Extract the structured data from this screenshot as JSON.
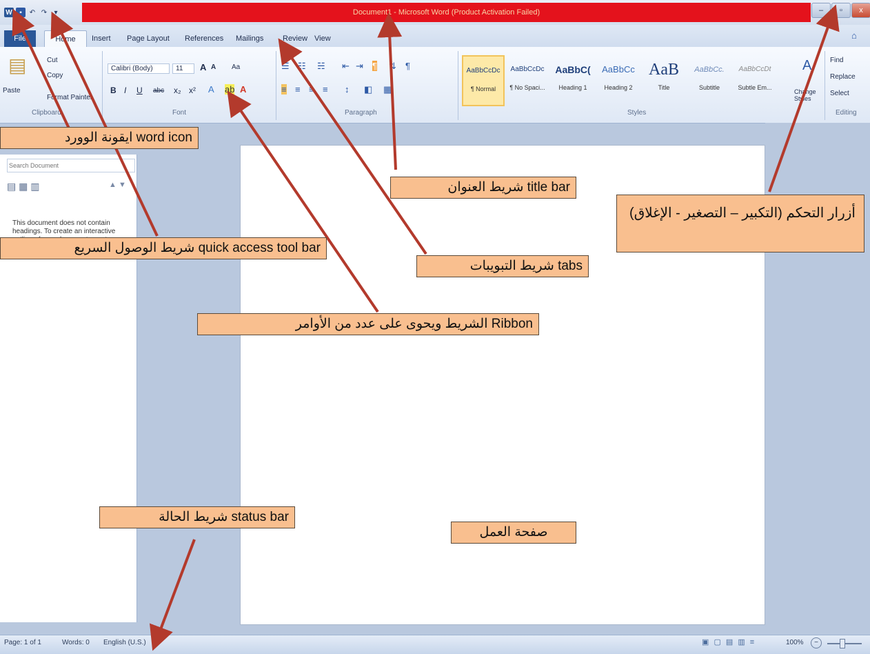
{
  "title_bar": {
    "title": "Document1 - Microsoft Word (Product Activation Failed)"
  },
  "quick_access": {
    "icons": [
      "word-icon",
      "save-icon",
      "undo-icon",
      "redo-icon",
      "customize-icon"
    ]
  },
  "window_controls": {
    "minimize": "–",
    "restore": "▫",
    "close": "x"
  },
  "tabs": {
    "file": "File",
    "home": "Home",
    "insert": "Insert",
    "page_layout": "Page Layout",
    "references": "References",
    "mailings": "Mailings",
    "review": "Review",
    "view": "View"
  },
  "ribbon": {
    "clipboard": {
      "label": "Clipboard",
      "paste": "Paste",
      "cut": "Cut",
      "copy": "Copy",
      "format_painter": "Format Painter"
    },
    "font": {
      "label": "Font",
      "font_name": "Calibri (Body)",
      "font_size": "11",
      "bold": "B",
      "italic": "I",
      "underline": "U",
      "strike": "abc",
      "subscript": "x₂",
      "superscript": "x²",
      "grow": "A",
      "shrink": "A",
      "change_case": "Aa"
    },
    "paragraph": {
      "label": "Paragraph"
    },
    "styles": {
      "label": "Styles",
      "items": [
        {
          "sample": "AaBbCcDc",
          "name": "¶ Normal"
        },
        {
          "sample": "AaBbCcDc",
          "name": "¶ No Spaci..."
        },
        {
          "sample": "AaBbC(",
          "name": "Heading 1"
        },
        {
          "sample": "AaBbCc",
          "name": "Heading 2"
        },
        {
          "sample": "AaB",
          "name": "Title"
        },
        {
          "sample": "AaBbCc.",
          "name": "Subtitle"
        },
        {
          "sample": "AaBbCcDt",
          "name": "Subtle Em..."
        }
      ],
      "change_styles": "Change Styles"
    },
    "editing": {
      "label": "Editing",
      "find": "Find",
      "replace": "Replace",
      "select": "Select"
    }
  },
  "nav_pane": {
    "search_placeholder": "Search Document",
    "message": "This document does not contain headings. To create an interactive outline of your document, create headings in your document by applying Heading Styles."
  },
  "status_bar": {
    "page": "Page: 1 of 1",
    "words": "Words: 0",
    "language": "English (U.S.)",
    "zoom": "100%"
  },
  "annotations": {
    "word_icon": "ايقونة الوورد word icon",
    "title_bar": "شريط العنوان title bar",
    "controls": "أزرار التحكم (التكبير – التصغير - الإغلاق)",
    "quick_access": "شريط الوصول السريع quick access tool bar",
    "tabs": "شريط التبويبات tabs",
    "ribbon": "الشريط ويحوى على عدد من الأوامر Ribbon",
    "status_bar": "شريط الحالة status bar",
    "work_page": "صفحة العمل"
  },
  "colors": {
    "title_highlight": "#e4121c",
    "annotation_bg": "#f9bf8f",
    "arrow": "#b33a2c",
    "ribbon_blue": "#2b5797"
  }
}
